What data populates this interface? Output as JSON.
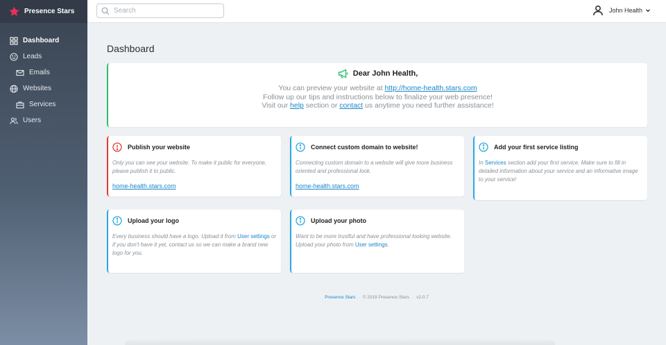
{
  "app": {
    "name": "Presence Stars",
    "brand_color": "#e8305a"
  },
  "sidebar": {
    "items": [
      {
        "label": "Dashboard",
        "icon": "grid-icon",
        "active": true
      },
      {
        "label": "Leads",
        "icon": "smile-icon"
      },
      {
        "label": "Emails",
        "icon": "mail-icon",
        "sub": true
      },
      {
        "label": "Websites",
        "icon": "globe-icon"
      },
      {
        "label": "Services",
        "icon": "briefcase-icon",
        "sub": true
      },
      {
        "label": "Users",
        "icon": "users-icon"
      }
    ]
  },
  "topbar": {
    "search_placeholder": "Search",
    "user_name": "John Health"
  },
  "page": {
    "title": "Dashboard"
  },
  "welcome": {
    "greeting": "Dear John Health,",
    "line1_pre": "You can preview your website at ",
    "line1_link": "http://home-health.stars.com",
    "line2": "Follow up our tips and instructions below to finalize your web presence!",
    "line3_pre": "Visit our ",
    "line3_link1": "help",
    "line3_mid": " section or ",
    "line3_link2": "contact",
    "line3_post": " us anytime you need further assistance!",
    "accent_color": "#2fbf71"
  },
  "tips": {
    "publish": {
      "title": "Publish your website",
      "body": "Only you can see your website. To make it public for everyone, please publish it to public.",
      "link": "home-health.stars.com"
    },
    "domain": {
      "title": "Connect custom domain to website!",
      "body": "Connecting custom domain to a website will give more business oriented and professional look.",
      "link": "home-health.stars.com"
    },
    "service": {
      "title": "Add your first service listing",
      "body_pre": "In ",
      "body_link": "Services",
      "body_post": " section add your first service. Make sure to fill in detailed information about your service and an informative image to your service!"
    },
    "logo": {
      "title": "Upload your logo",
      "body_pre": "Every business should have a logo. Upload it from ",
      "body_link": "User settings",
      "body_post": " or if you don't have it yet, contact us so we can make a brand new logo for you."
    },
    "photo": {
      "title": "Upload your photo",
      "body_pre": "Want to be more trustful and have professional looking website. Upload your photo from ",
      "body_link": "User settings",
      "body_post": "."
    }
  },
  "footer": {
    "link": "Presence Stars",
    "copyright": "© 2019 Presence Stars",
    "version": "v2.0.7"
  },
  "colors": {
    "info": "#29a9e1",
    "danger": "#e53935",
    "link": "#1a86c8"
  }
}
